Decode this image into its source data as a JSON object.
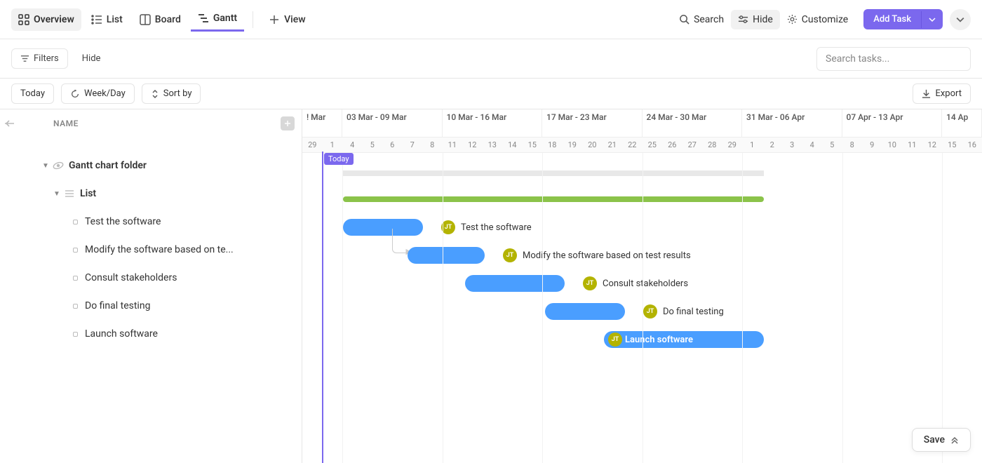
{
  "topbar": {
    "overview": "Overview",
    "list": "List",
    "board": "Board",
    "gantt": "Gantt",
    "view": "View",
    "search": "Search",
    "hide": "Hide",
    "customize": "Customize",
    "add_task": "Add Task"
  },
  "subbar": {
    "filters": "Filters",
    "hide": "Hide",
    "search_placeholder": "Search tasks..."
  },
  "ctrl": {
    "today": "Today",
    "weekday": "Week/Day",
    "sortby": "Sort by",
    "export": "Export"
  },
  "left": {
    "heading": "NAME",
    "folder": "Gantt chart folder",
    "list": "List",
    "tasks": [
      "Test the software",
      "Modify the software based on te...",
      "Consult stakeholders",
      "Do final testing",
      "Launch software"
    ]
  },
  "timeline": {
    "today_label": "Today",
    "weeks": [
      {
        "label": "! Mar",
        "days": [
          "29",
          "1"
        ]
      },
      {
        "label": "03 Mar - 09 Mar",
        "days": [
          "4",
          "5",
          "6",
          "7",
          "8"
        ]
      },
      {
        "label": "10 Mar - 16 Mar",
        "days": [
          "11",
          "12",
          "13",
          "14",
          "15"
        ]
      },
      {
        "label": "17 Mar - 23 Mar",
        "days": [
          "18",
          "19",
          "20",
          "21",
          "22"
        ]
      },
      {
        "label": "24 Mar - 30 Mar",
        "days": [
          "25",
          "26",
          "27",
          "28",
          "29"
        ]
      },
      {
        "label": "31 Mar - 06 Apr",
        "days": [
          "1",
          "2",
          "3",
          "4",
          "5"
        ]
      },
      {
        "label": "07 Apr - 13 Apr",
        "days": [
          "8",
          "9",
          "10",
          "11",
          "12"
        ]
      },
      {
        "label": "14 Ap",
        "days": [
          "15",
          "16"
        ]
      }
    ]
  },
  "bars": {
    "assignee_initials": "JT",
    "labels": [
      "Test the software",
      "Modify the software based on test results",
      "Consult stakeholders",
      "Do final testing",
      "Launch software"
    ]
  },
  "save": "Save",
  "colors": {
    "accent": "#7b68ee",
    "bar": "#4a9eff",
    "group": "#8bc34a",
    "assignee": "#b3b300"
  },
  "chart_data": {
    "type": "gantt",
    "date_range": {
      "start": "2025-02-29",
      "end": "2025-04-16"
    },
    "today": "2025-03-01",
    "groups": [
      {
        "name": "Gantt chart folder / List",
        "start": "2025-03-01",
        "end": "2025-03-29"
      }
    ],
    "tasks": [
      {
        "name": "Test the software",
        "start": "2025-03-01",
        "end": "2025-03-06",
        "assignee": "JT"
      },
      {
        "name": "Modify the software based on test results",
        "start": "2025-03-05",
        "end": "2025-03-10",
        "assignee": "JT",
        "depends_on": "Test the software"
      },
      {
        "name": "Consult stakeholders",
        "start": "2025-03-09",
        "end": "2025-03-16",
        "assignee": "JT"
      },
      {
        "name": "Do final testing",
        "start": "2025-03-14",
        "end": "2025-03-20",
        "assignee": "JT"
      },
      {
        "name": "Launch software",
        "start": "2025-03-18",
        "end": "2025-03-29",
        "assignee": "JT"
      }
    ]
  }
}
